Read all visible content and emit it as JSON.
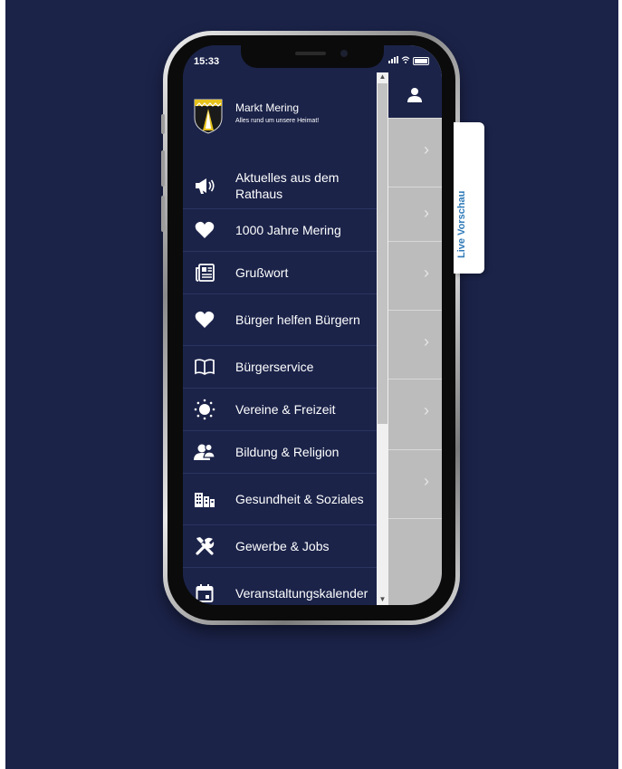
{
  "status": {
    "time": "15:33"
  },
  "brand": {
    "name": "Markt Mering",
    "tagline": "Alles rund um unsere Heimat!"
  },
  "menu": [
    {
      "label": "Aktuelles aus dem Rathaus",
      "icon": "megaphone-icon"
    },
    {
      "label": "1000 Jahre Mering",
      "icon": "heart-icon"
    },
    {
      "label": "Grußwort",
      "icon": "newspaper-icon"
    },
    {
      "label": "Bürger helfen Bürgern",
      "icon": "heart-icon"
    },
    {
      "label": "Bürgerservice",
      "icon": "book-icon"
    },
    {
      "label": "Vereine & Freizeit",
      "icon": "sun-icon"
    },
    {
      "label": "Bildung & Religion",
      "icon": "people-icon"
    },
    {
      "label": "Gesundheit & Soziales",
      "icon": "buildings-icon"
    },
    {
      "label": "Gewerbe & Jobs",
      "icon": "tools-icon"
    },
    {
      "label": "Veranstaltungskalender",
      "icon": "calendar-icon"
    }
  ],
  "live_preview": {
    "label": "Live Vorschau"
  },
  "colors": {
    "background": "#1b2349",
    "accent": "#2f7ab8"
  }
}
